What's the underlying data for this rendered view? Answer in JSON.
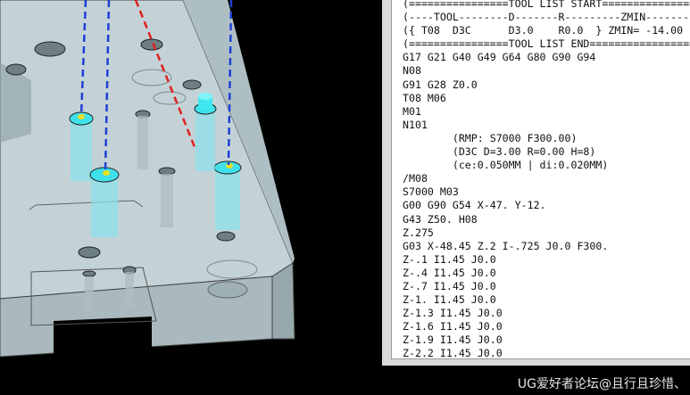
{
  "program": {
    "lines": [
      "(================TOOL LIST START================",
      "(----TOOL--------D-------R---------ZMIN---------",
      "({ T08  D3C      D3.0    R0.0  } ZMIN= -14.00",
      "(================TOOL LIST END==================",
      "G17 G21 G40 G49 G64 G80 G90 G94",
      "N08",
      "G91 G28 Z0.0",
      "T08 M06",
      "M01",
      "N101",
      "        (RMP: S7000 F300.00)",
      "        (D3C D=3.00 R=0.00 H=8)",
      "        (ce:0.050MM | di:0.020MM)",
      "/M08",
      "S7000 M03",
      "G00 G90 G54 X-47. Y-12.",
      "G43 Z50. H08",
      "Z.275",
      "G03 X-48.45 Z.2 I-.725 J0.0 F300.",
      "Z-.1 I1.45 J0.0",
      "Z-.4 I1.45 J0.0",
      "Z-.7 I1.45 J0.0",
      "Z-1. I1.45 J0.0",
      "Z-1.3 I1.45 J0.0",
      "Z-1.6 I1.45 J0.0",
      "Z-1.9 I1.45 J0.0",
      "Z-2.2 I1.45 J0.0"
    ]
  },
  "watermark": "UG爱好者论坛@且行且珍惜、",
  "colors": {
    "viewport_bg": "#000000",
    "part_fill": "#c3d3d8",
    "toolpath_rapid": "#1f3fd6",
    "toolpath_lead": "#e02020",
    "tool": "#33e6f0"
  }
}
